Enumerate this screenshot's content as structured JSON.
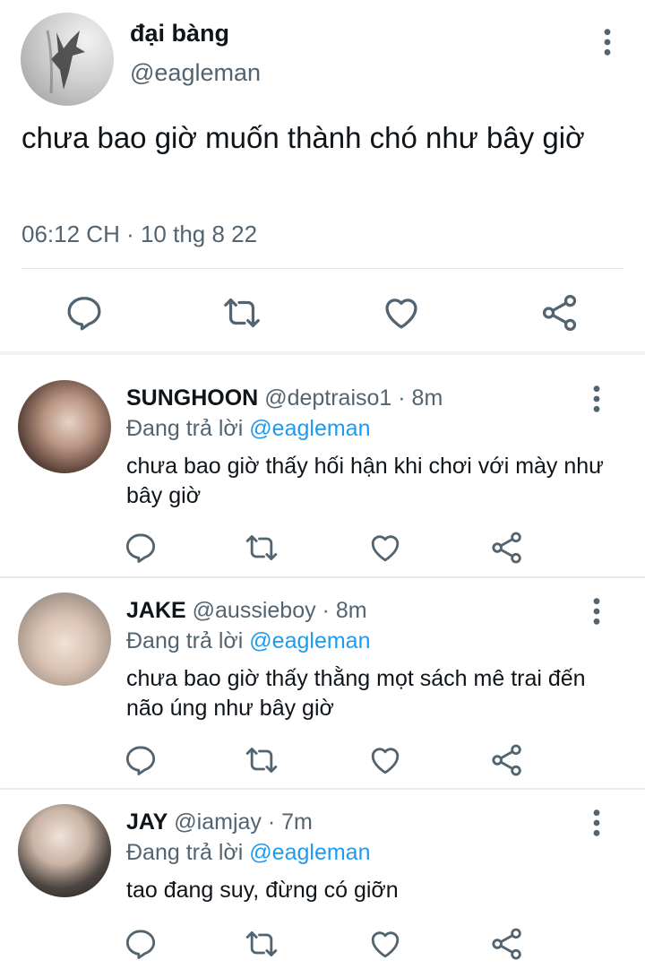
{
  "colors": {
    "text": "#0f1419",
    "secondary": "#536471",
    "link": "#1d9bf0"
  },
  "tweet": {
    "display_name": "đại bàng",
    "handle": "@eagleman",
    "text": "chưa bao giờ muốn thành chó như bây giờ",
    "meta": "06:12 CH · 10 thg 8 22",
    "actions": [
      "reply-icon",
      "retweet-icon",
      "like-icon",
      "share-icon"
    ]
  },
  "replies": [
    {
      "name": "SUNGHOON",
      "handle": "@deptraiso1",
      "time": "· 8m",
      "replying_label": "Đang trả lời",
      "replying_to": "@eagleman",
      "text": "chưa bao giờ thấy hối hận khi chơi với mày như bây giờ"
    },
    {
      "name": "JAKE",
      "handle": "@aussieboy",
      "time": "· 8m",
      "replying_label": "Đang trả lời",
      "replying_to": "@eagleman",
      "text": "chưa bao giờ thấy thằng mọt sách mê trai đến não úng như bây giờ"
    },
    {
      "name": "JAY",
      "handle": "@iamjay",
      "time": "· 7m",
      "replying_label": "Đang trả lời",
      "replying_to": "@eagleman",
      "text": "tao đang suy, đừng có giỡn"
    }
  ]
}
